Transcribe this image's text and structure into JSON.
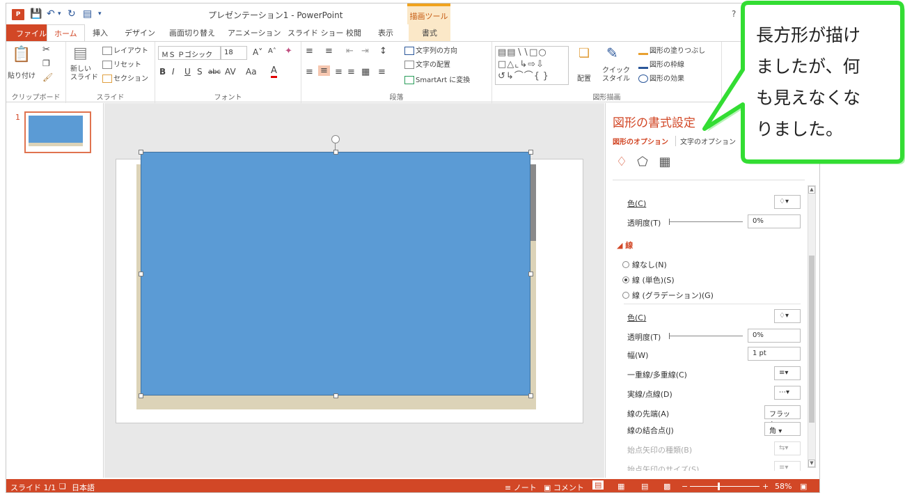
{
  "titlebar": {
    "title": "プレゼンテーション1 - PowerPoint",
    "context_group": "描画ツール",
    "help": "?"
  },
  "tabs": [
    "ファイル",
    "ホーム",
    "挿入",
    "デザイン",
    "画面切り替え",
    "アニメーション",
    "スライド ショー",
    "校閲",
    "表示",
    "書式"
  ],
  "ribbon": {
    "clipboard": {
      "paste": "貼り付け",
      "label": "クリップボード"
    },
    "slides": {
      "new_slide": "新しい\nスライド",
      "layout": "レイアウト",
      "reset": "リセット",
      "section": "セクション",
      "label": "スライド"
    },
    "font": {
      "font_name": "ＭＳ Ｐゴシック",
      "font_size": "18",
      "label": "フォント"
    },
    "paragraph": {
      "text_direction": "文字列の方向",
      "align_text": "文字の配置",
      "smartart": "SmartArt に変換",
      "label": "段落"
    },
    "drawing": {
      "arrange": "配置",
      "quick_styles": "クイック\nスタイル",
      "fill": "図形の塗りつぶし",
      "outline": "図形の枠線",
      "effects": "図形の効果",
      "label": "図形描画"
    }
  },
  "thumbnails": {
    "slide_number": "1"
  },
  "format_pane": {
    "title": "図形の書式設定",
    "tab_shape": "図形のオプション",
    "tab_text": "文字のオプション",
    "fill_color_label": "色(C)",
    "fill_transparency_label": "透明度(T)",
    "fill_transparency_value": "0%",
    "line_section": "線",
    "line_none": "線なし(N)",
    "line_solid": "線 (単色)(S)",
    "line_gradient": "線 (グラデーション)(G)",
    "line_color_label": "色(C)",
    "line_transparency_label": "透明度(T)",
    "line_transparency_value": "0%",
    "width_label": "幅(W)",
    "width_value": "1 pt",
    "compound_label": "一重線/多重線(C)",
    "dash_label": "実線/点線(D)",
    "cap_label": "線の先端(A)",
    "cap_value": "フラット",
    "join_label": "線の結合点(J)",
    "join_value": "角",
    "begin_arrow_label": "始点矢印の種類(B)",
    "begin_arrow_size_label": "始点矢印のサイズ(S)"
  },
  "statusbar": {
    "slide_info": "スライド 1/1",
    "language": "日本語",
    "notes": "ノート",
    "comments": "コメント",
    "zoom": "58%"
  },
  "callout": {
    "text": "長方形が描けましたが、何も見えなくなりました。",
    "lines": [
      "長方形が描け",
      "ましたが、何",
      "も見えなくな",
      "りました。"
    ],
    "fill_color": "#ffffff",
    "border_color": "#33dd33"
  }
}
